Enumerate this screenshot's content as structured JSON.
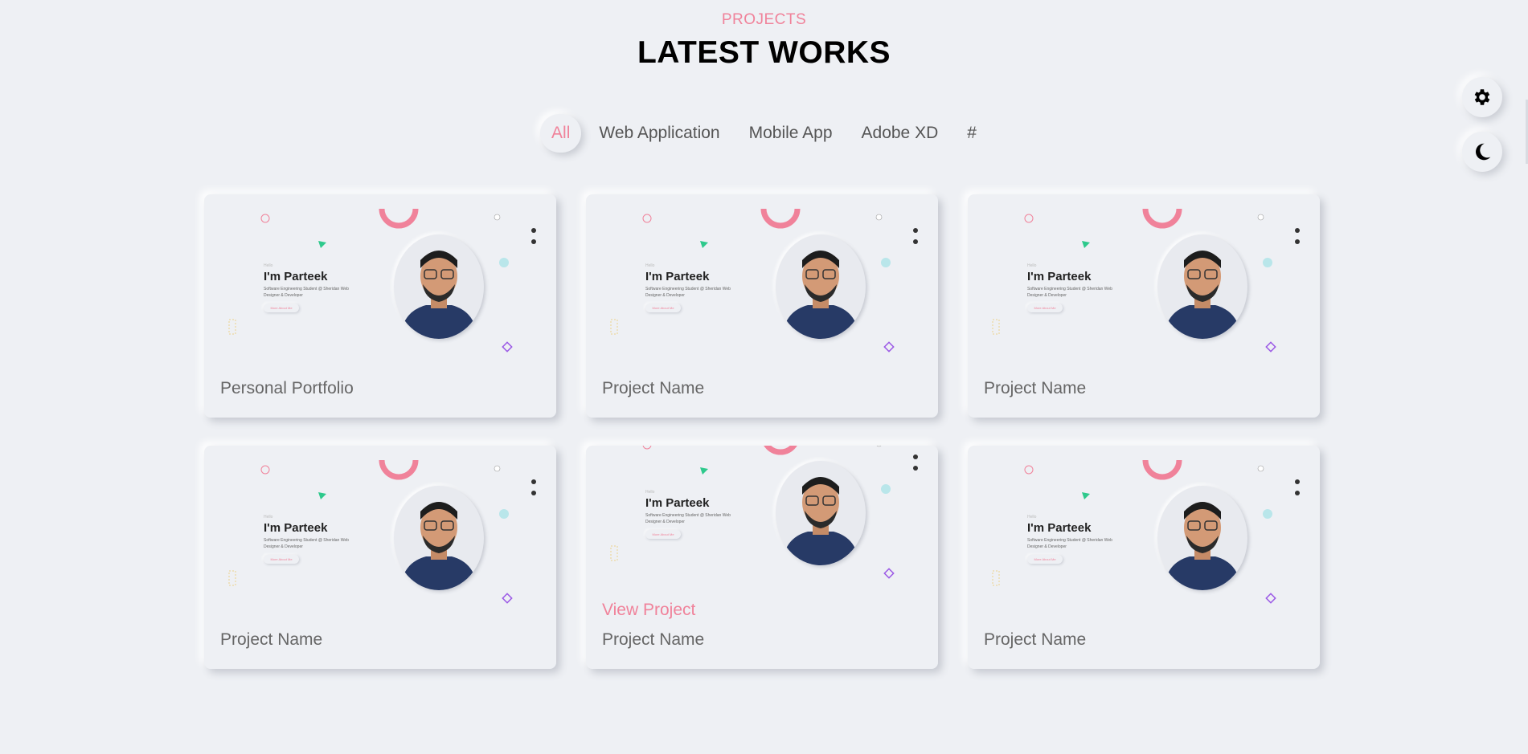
{
  "header": {
    "kicker": "PROJECTS",
    "title": "LATEST WORKS"
  },
  "filters": [
    {
      "label": "All",
      "active": true
    },
    {
      "label": "Web Application",
      "active": false
    },
    {
      "label": "Mobile App",
      "active": false
    },
    {
      "label": "Adobe XD",
      "active": false
    },
    {
      "label": "#",
      "active": false
    }
  ],
  "side_controls": {
    "settings_icon": "gear-icon",
    "theme_icon": "moon-icon"
  },
  "preview": {
    "greeting": "Hello",
    "name": "I'm Parteek",
    "description": "Software Engineering Student @ Sheridan Web Designer & Developer",
    "button": "More About Me"
  },
  "projects": [
    {
      "name": "Personal Portfolio"
    },
    {
      "name": "Project Name"
    },
    {
      "name": "Project Name"
    },
    {
      "name": "Project Name"
    },
    {
      "name": "Project Name",
      "view_label": "View Project"
    },
    {
      "name": "Project Name"
    }
  ],
  "colors": {
    "accent": "#f0829a",
    "background": "#eef0f4",
    "title": "#000000"
  }
}
